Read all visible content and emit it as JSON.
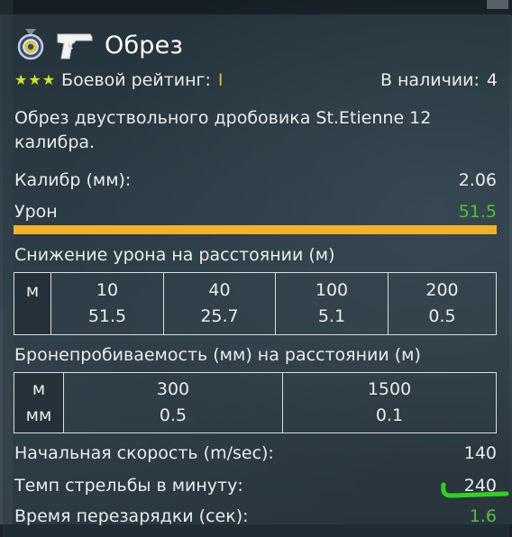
{
  "item": {
    "title": "Обрез",
    "rating_label": "Боевой рейтинг:",
    "rating_value": "I",
    "availability_label": "В наличии:",
    "availability_value": "4",
    "description": "Обрез двуствольного дробовика St.Etienne 12 калибра."
  },
  "stats": {
    "caliber_label": "Калибр (мм):",
    "caliber_value": "2.06",
    "damage_label": "Урон",
    "damage_value": "51.5",
    "damage_bar_fraction": 1.0,
    "muzzle_label": "Начальная скорость (m/sec):",
    "muzzle_value": "140",
    "rof_label": "Темп стрельбы в минуту:",
    "rof_value": "240",
    "reload_label": "Время перезарядки (сек):",
    "reload_value": "1.6"
  },
  "falloff": {
    "label": "Снижение урона на расстоянии (м)",
    "unit": "м",
    "distances": [
      "10",
      "40",
      "100",
      "200"
    ],
    "values": [
      "51.5",
      "25.7",
      "5.1",
      "0.5"
    ]
  },
  "penetration": {
    "label": "Бронепробиваемость (мм) на расстоянии (м)",
    "unit_top": "м",
    "unit_bottom": "мм",
    "distances": [
      "300",
      "1500"
    ],
    "values": [
      "0.5",
      "0.1"
    ]
  },
  "icons": {
    "medal": "medal-icon",
    "weapon": "pistol-icon",
    "star": "star-icon"
  },
  "colors": {
    "accent_yellow": "#f2b12a",
    "positive_green": "#4fc234",
    "star_color": "#d4e21a"
  }
}
